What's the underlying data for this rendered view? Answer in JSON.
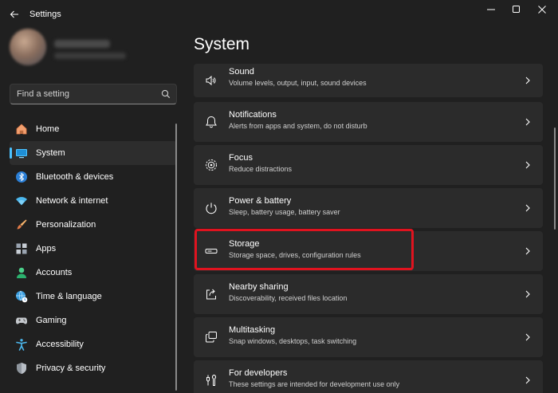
{
  "window": {
    "title": "Settings"
  },
  "search": {
    "placeholder": "Find a setting"
  },
  "sidebar": {
    "items": [
      {
        "label": "Home",
        "icon": "home-icon"
      },
      {
        "label": "System",
        "icon": "system-icon",
        "active": true
      },
      {
        "label": "Bluetooth & devices",
        "icon": "bluetooth-icon"
      },
      {
        "label": "Network & internet",
        "icon": "wifi-icon"
      },
      {
        "label": "Personalization",
        "icon": "brush-icon"
      },
      {
        "label": "Apps",
        "icon": "apps-icon"
      },
      {
        "label": "Accounts",
        "icon": "accounts-icon"
      },
      {
        "label": "Time & language",
        "icon": "globe-clock-icon"
      },
      {
        "label": "Gaming",
        "icon": "gamepad-icon"
      },
      {
        "label": "Accessibility",
        "icon": "accessibility-icon"
      },
      {
        "label": "Privacy & security",
        "icon": "shield-icon"
      }
    ]
  },
  "main": {
    "title": "System",
    "cards": [
      {
        "title": "Sound",
        "subtitle": "Volume levels, output, input, sound devices",
        "icon": "speaker-icon"
      },
      {
        "title": "Notifications",
        "subtitle": "Alerts from apps and system, do not disturb",
        "icon": "bell-icon"
      },
      {
        "title": "Focus",
        "subtitle": "Reduce distractions",
        "icon": "focus-icon"
      },
      {
        "title": "Power & battery",
        "subtitle": "Sleep, battery usage, battery saver",
        "icon": "power-icon"
      },
      {
        "title": "Storage",
        "subtitle": "Storage space, drives, configuration rules",
        "icon": "storage-icon",
        "highlighted": true
      },
      {
        "title": "Nearby sharing",
        "subtitle": "Discoverability, received files location",
        "icon": "share-icon"
      },
      {
        "title": "Multitasking",
        "subtitle": "Snap windows, desktops, task switching",
        "icon": "multitasking-icon"
      },
      {
        "title": "For developers",
        "subtitle": "These settings are intended for development use only",
        "icon": "developer-icon"
      }
    ]
  },
  "colors": {
    "accent": "#4cc2ff",
    "highlight": "#e0131f",
    "background": "#202020",
    "card": "#2b2b2b"
  }
}
